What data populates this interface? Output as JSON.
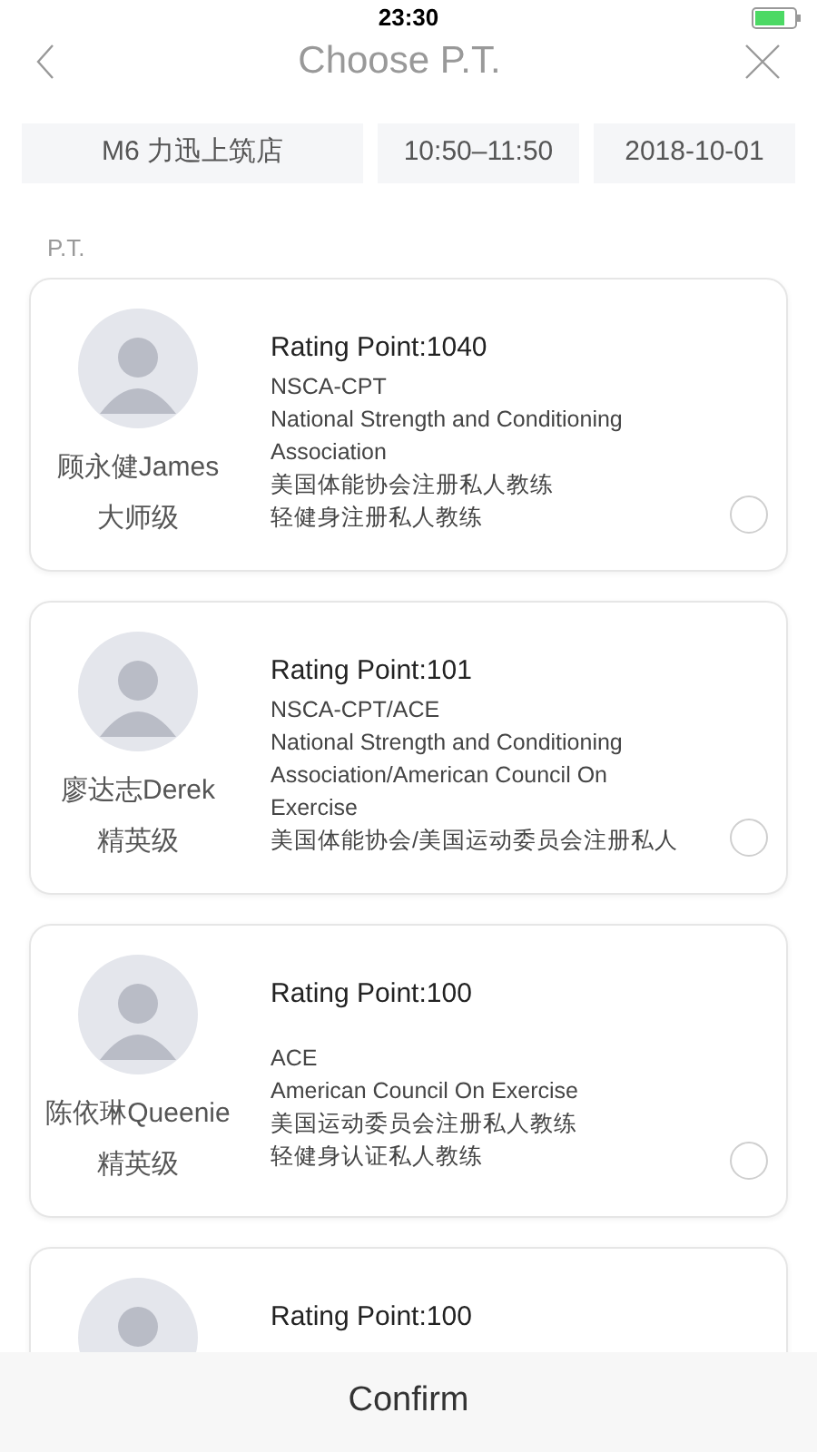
{
  "status_bar": {
    "time": "23:30"
  },
  "nav": {
    "title": "Choose P.T."
  },
  "filters": [
    "M6 力迅上筑店",
    "10:50–11:50",
    "2018-10-01"
  ],
  "section_label": "P.T.",
  "trainers": [
    {
      "name": "顾永健James",
      "level": "大师级",
      "rating": "Rating Point:1040",
      "certifications": [
        "NSCA-CPT",
        "National Strength and Conditioning Association",
        "美国体能协会注册私人教练",
        "轻健身注册私人教练"
      ],
      "selected": false
    },
    {
      "name": "廖达志Derek",
      "level": "精英级",
      "rating": "Rating Point:101",
      "certifications": [
        "NSCA-CPT/ACE",
        "National Strength and Conditioning Association/American Council On Exercise",
        "美国体能协会/美国运动委员会注册私人"
      ],
      "selected": false
    },
    {
      "name": "陈依琳Queenie",
      "level": "精英级",
      "rating": "Rating Point:100",
      "certifications": [
        "ACE",
        "American Council On Exercise",
        "美国运动委员会注册私人教练",
        "轻健身认证私人教练"
      ],
      "selected": false
    },
    {
      "rating": "Rating Point:100"
    }
  ],
  "confirm_button": "Confirm"
}
